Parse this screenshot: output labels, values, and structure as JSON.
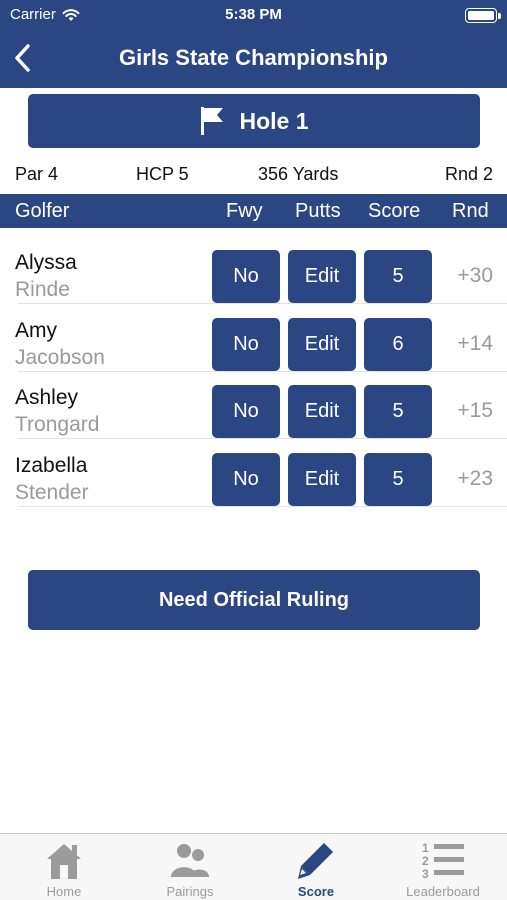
{
  "status_bar": {
    "carrier": "Carrier",
    "time": "5:38 PM"
  },
  "nav": {
    "title": "Girls State Championship"
  },
  "hole": {
    "label": "Hole 1"
  },
  "info": {
    "par": "Par 4",
    "hcp": "HCP 5",
    "yards": "356 Yards",
    "round": "Rnd 2"
  },
  "table": {
    "headers": {
      "golfer": "Golfer",
      "fwy": "Fwy",
      "putts": "Putts",
      "score": "Score",
      "rnd": "Rnd"
    },
    "rows": [
      {
        "first": "Alyssa",
        "last": "Rinde",
        "fwy": "No",
        "putts": "Edit",
        "score": "5",
        "rnd": "+30"
      },
      {
        "first": "Amy",
        "last": "Jacobson",
        "fwy": "No",
        "putts": "Edit",
        "score": "6",
        "rnd": "+14"
      },
      {
        "first": "Ashley",
        "last": "Trongard",
        "fwy": "No",
        "putts": "Edit",
        "score": "5",
        "rnd": "+15"
      },
      {
        "first": "Izabella",
        "last": "Stender",
        "fwy": "No",
        "putts": "Edit",
        "score": "5",
        "rnd": "+23"
      }
    ]
  },
  "ruling": {
    "label": "Need Official Ruling"
  },
  "tabbar": {
    "tabs": [
      {
        "label": "Home",
        "icon": "home-icon",
        "active": false
      },
      {
        "label": "Pairings",
        "icon": "people-icon",
        "active": false
      },
      {
        "label": "Score",
        "icon": "pencil-icon",
        "active": true
      },
      {
        "label": "Leaderboard",
        "icon": "numbered-list-icon",
        "active": false
      }
    ]
  },
  "colors": {
    "primary": "#2a4683",
    "secondary_text": "#9a9a9a",
    "tab_inactive": "#9b9b9b"
  }
}
